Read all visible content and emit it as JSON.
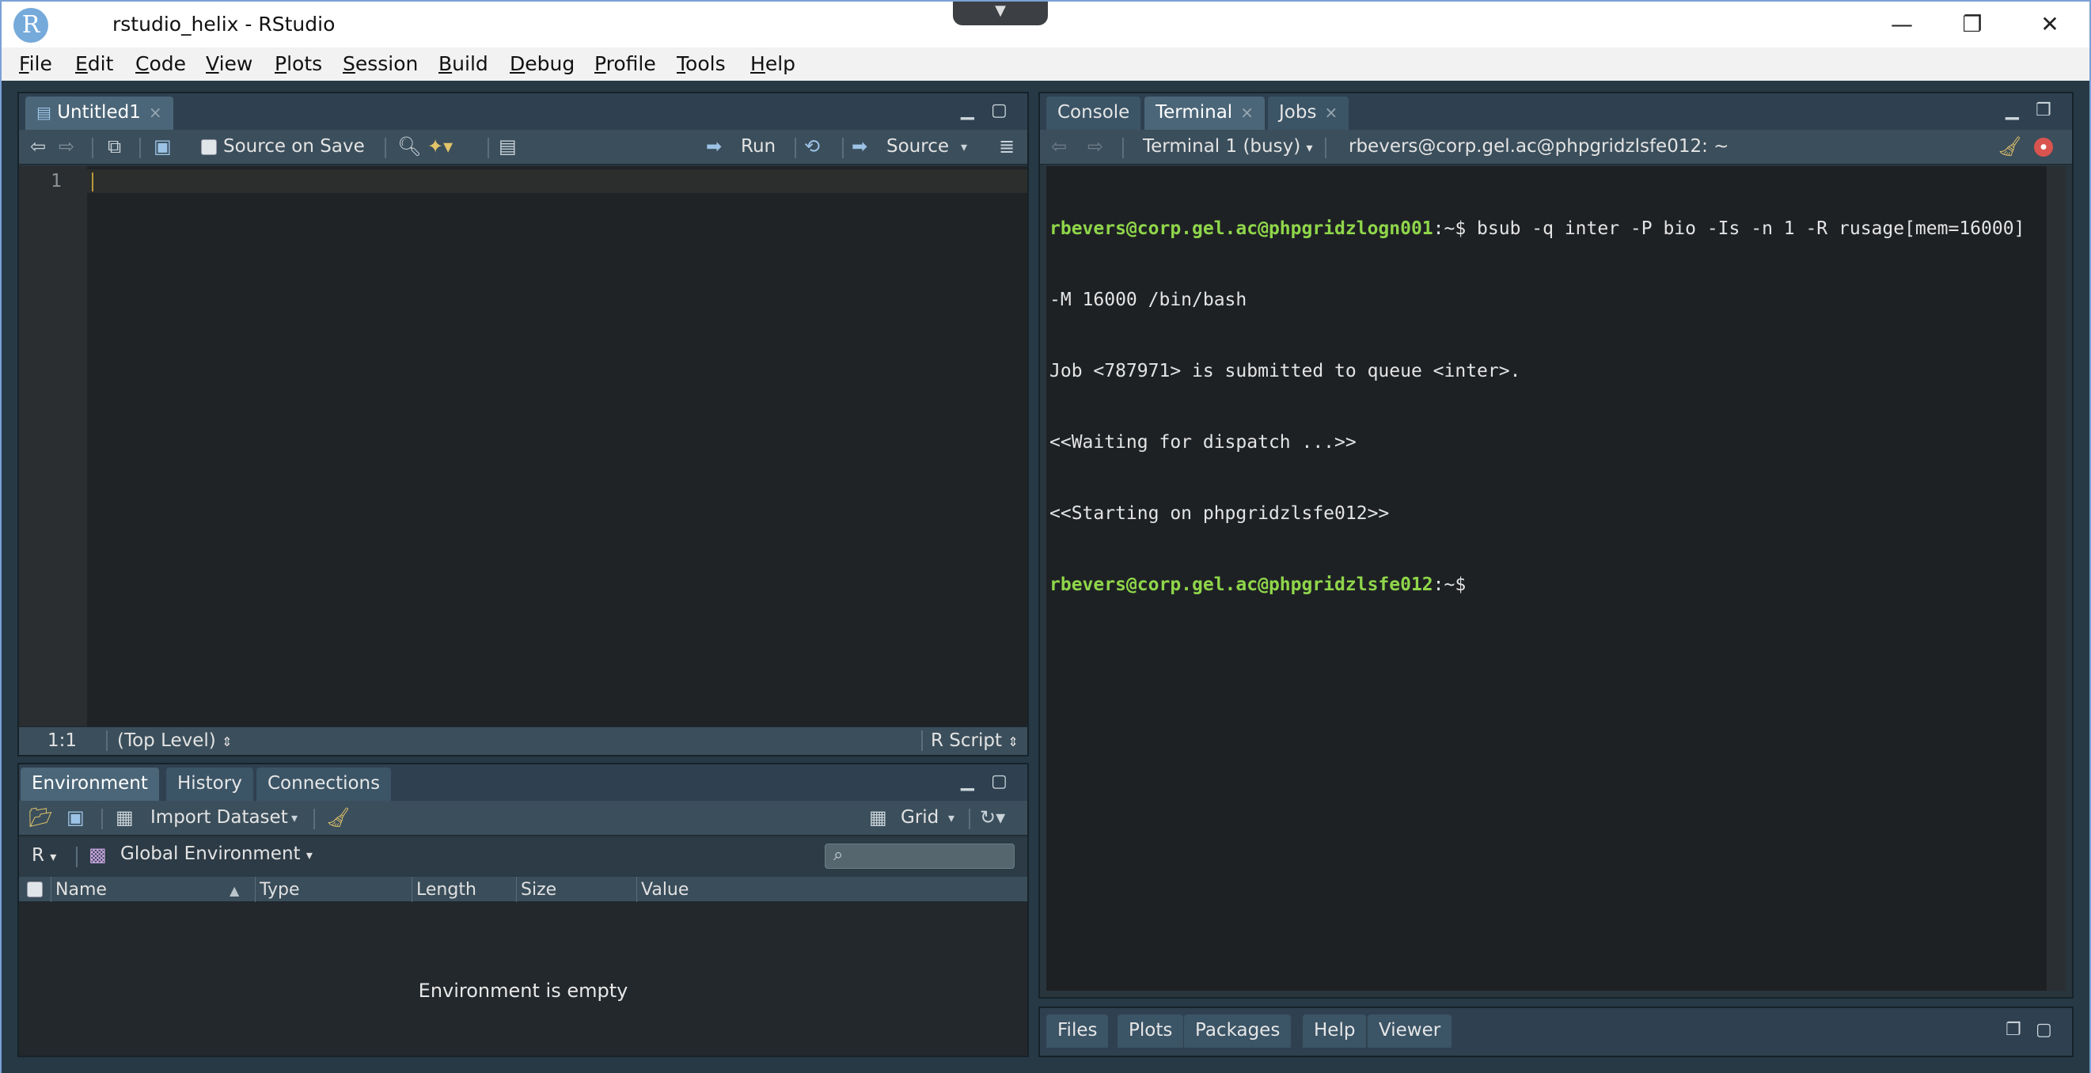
{
  "window": {
    "app_logo": "R",
    "title": "rstudio_helix - RStudio",
    "dropdown_glyph": "▼",
    "minimize": "—",
    "restore": "❐",
    "close": "✕"
  },
  "menu": [
    {
      "label": "File",
      "u": "F",
      "rest": "ile"
    },
    {
      "label": "Edit",
      "u": "E",
      "rest": "dit"
    },
    {
      "label": "Code",
      "u": "C",
      "rest": "ode"
    },
    {
      "label": "View",
      "u": "V",
      "rest": "iew"
    },
    {
      "label": "Plots",
      "u": "P",
      "rest": "lots"
    },
    {
      "label": "Session",
      "u": "S",
      "rest": "ession"
    },
    {
      "label": "Build",
      "u": "B",
      "rest": "uild"
    },
    {
      "label": "Debug",
      "u": "D",
      "rest": "ebug"
    },
    {
      "label": "Profile",
      "u": "P",
      "rest": "rofile"
    },
    {
      "label": "Tools",
      "u": "T",
      "rest": "ools"
    },
    {
      "label": "Help",
      "u": "H",
      "rest": "elp"
    }
  ],
  "source_pane": {
    "tab_label": "Untitled1",
    "source_on_save": "Source on Save",
    "run": "Run",
    "source": "Source",
    "line_numbers": [
      "1"
    ],
    "status": {
      "position": "1:1",
      "scope": "(Top Level)",
      "file_type": "R Script"
    }
  },
  "env_pane": {
    "tabs": [
      "Environment",
      "History",
      "Connections"
    ],
    "import_dataset": "Import Dataset",
    "grid": "Grid",
    "r_selector": "R",
    "global_env": "Global Environment",
    "search_placeholder": "",
    "columns": [
      "Name",
      "Type",
      "Length",
      "Size",
      "Value"
    ],
    "empty_message": "Environment is empty"
  },
  "console_pane": {
    "tabs": [
      "Console",
      "Terminal",
      "Jobs"
    ],
    "terminal_selector": "Terminal 1 (busy)",
    "terminal_title": "rbevers@corp.gel.ac@phpgridzlsfe012: ~",
    "lines": [
      {
        "user": "rbevers@corp.gel.ac@phpgridzlogn001",
        "text": ":~$ bsub -q inter -P bio -Is -n 1 -R rusage[mem=16000]"
      },
      {
        "user": "",
        "text": "-M 16000 /bin/bash"
      },
      {
        "user": "",
        "text": "Job <787971> is submitted to queue <inter>."
      },
      {
        "user": "",
        "text": "<<Waiting for dispatch ...>>"
      },
      {
        "user": "",
        "text": "<<Starting on phpgridzlsfe012>>"
      },
      {
        "user": "rbevers@corp.gel.ac@phpgridzlsfe012",
        "text": ":~$"
      }
    ]
  },
  "files_pane": {
    "tabs": [
      "Files",
      "Plots",
      "Packages",
      "Help",
      "Viewer"
    ]
  }
}
